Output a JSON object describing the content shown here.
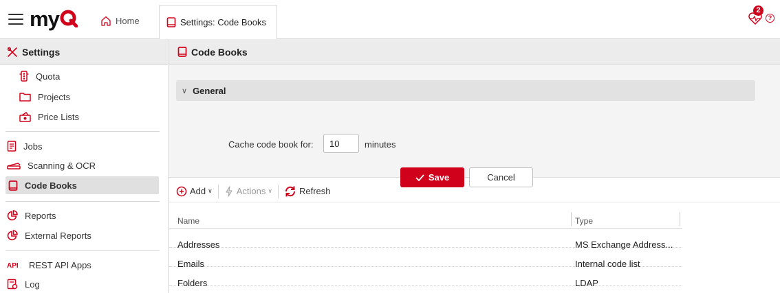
{
  "topbar": {
    "logo_text": "my",
    "home_tab": "Home",
    "active_tab": "Settings: Code Books",
    "notification_count": "2",
    "help_glyph": "?"
  },
  "sidebar": {
    "title": "Settings",
    "items": [
      {
        "label": "Quota",
        "icon": "traffic-light-icon"
      },
      {
        "label": "Projects",
        "icon": "folder-icon"
      },
      {
        "label": "Price Lists",
        "icon": "price-list-icon"
      },
      {
        "label": "Jobs",
        "icon": "document-icon"
      },
      {
        "label": "Scanning & OCR",
        "icon": "scanner-icon"
      },
      {
        "label": "Code Books",
        "icon": "book-icon"
      },
      {
        "label": "Reports",
        "icon": "pie-chart-icon"
      },
      {
        "label": "External Reports",
        "icon": "pie-chart-icon"
      },
      {
        "label": "REST API Apps",
        "icon": "api-icon"
      },
      {
        "label": "Log",
        "icon": "log-icon"
      }
    ]
  },
  "main": {
    "title": "Code Books",
    "section": {
      "title": "General",
      "expanded": true
    },
    "cache": {
      "label": "Cache code book for:",
      "value": "10",
      "unit": "minutes"
    },
    "save_label": "Save",
    "cancel_label": "Cancel",
    "toolbar": {
      "add": "Add",
      "actions": "Actions",
      "refresh": "Refresh"
    },
    "table": {
      "columns": [
        "Name",
        "Type"
      ],
      "rows": [
        [
          "Addresses",
          "MS Exchange Address..."
        ],
        [
          "Emails",
          "Internal code list"
        ],
        [
          "Folders",
          "LDAP"
        ]
      ]
    }
  },
  "colors": {
    "accent": "#d0021b",
    "header_bg": "#ececec",
    "active_item": "#e0e0e0"
  }
}
